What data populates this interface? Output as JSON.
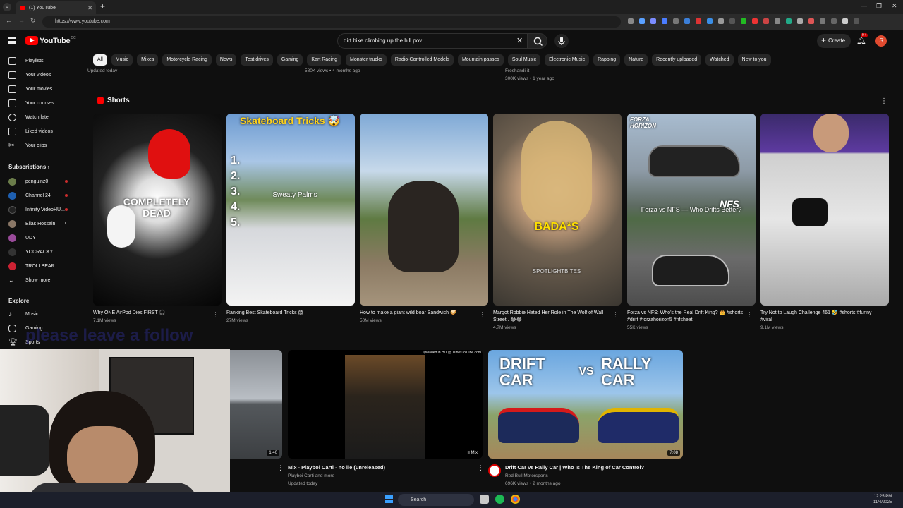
{
  "browser": {
    "tab_title": "(1) YouTube",
    "url": "https://www.youtube.com",
    "new_tab": "+"
  },
  "header": {
    "logo_text": "YouTube",
    "country_code": "CC",
    "search_query": "dirt bike climbing up the hill pov",
    "create_label": "Create",
    "notif_count": "9+",
    "avatar_letter": "S"
  },
  "chips": [
    "All",
    "Music",
    "Mixes",
    "Motorcycle Racing",
    "News",
    "Test drives",
    "Gaming",
    "Kart Racing",
    "Monster trucks",
    "Radio-Controlled Models",
    "Mountain passes",
    "Soul Music",
    "Electronic Music",
    "Rapping",
    "Nature",
    "Recently uploaded",
    "Watched",
    "New to you"
  ],
  "sidebar": {
    "you_items": [
      "Playlists",
      "Your videos",
      "Your movies",
      "Your courses",
      "Watch later",
      "Liked videos",
      "Your clips"
    ],
    "subscriptions_title": "Subscriptions",
    "subscriptions": [
      "penguinz0",
      "Channel 24",
      "Infinity VideoHU...",
      "Elias Hossain",
      "UDY",
      "YOCRACKY",
      "TROLI BEAR"
    ],
    "show_more": "Show more",
    "explore_title": "Explore",
    "explore_items": [
      "Music",
      "Gaming",
      "Sports"
    ]
  },
  "previous_row": {
    "left_meta": "Updated today",
    "mid_meta": "580K views • 4 months ago",
    "right_channel": "Freshandi-it",
    "right_meta": "300K views • 1 year ago"
  },
  "shorts": {
    "title": "Shorts",
    "items": [
      {
        "title": "Why ONE AirPod Dies FIRST 🎧",
        "views": "7.1M views",
        "overlay": "COMPLETELY DEAD"
      },
      {
        "title": "Ranking Best Skateboard Tricks 😱",
        "views": "27M views",
        "overlay": "Skateboard Tricks 🤯",
        "overlay2": "1.\n2.\n3.\n4.\n5.",
        "overlay3": "Sweaty Palms"
      },
      {
        "title": "How to make a giant wild boar Sandwich 🥪",
        "views": "50M views",
        "overlay": ""
      },
      {
        "title": "Margot Robbie Hated Her Role in The Wolf of Wall Street.. 😂😂",
        "views": "4.7M views",
        "overlay": "BADA*S",
        "overlay2": "SPOTLIGHTBITES"
      },
      {
        "title": "Forza vs NFS: Who's the Real Drift King? 👑 #shorts #drift #forzahorizon5 #nfsheat",
        "views": "55K views",
        "overlay": "Forza vs NFS — Who Drifts Better?",
        "overlay2": "FORZA HORIZON",
        "overlay3": "NFS"
      },
      {
        "title": "Try Not to Laugh Challenge 461 🤣 #shorts #funny #viral",
        "views": "9.1M views",
        "overlay": ""
      }
    ]
  },
  "videos": [
    {
      "title": "",
      "meta1": "",
      "meta2": "",
      "duration": "1:40"
    },
    {
      "title": "Mix - Playboi Carti - no lie (unreleased)",
      "meta1": "Playboi Carti and more",
      "meta2": "Updated today",
      "duration": "Mix",
      "banner": "uploaded in HD @ TunesToTube.com"
    },
    {
      "title": "Drift Car vs Rally Car | Who Is The King of Car Control?",
      "meta1": "Red Bull Motorsports",
      "meta2": "696K views • 2 months ago",
      "duration": "7:08",
      "thumb_left": "DRIFT CAR",
      "thumb_vs": "VS",
      "thumb_right": "RALLY CAR"
    }
  ],
  "overlay_caption": "please leave a follow",
  "taskbar": {
    "search_label": "Search",
    "time": "12:25 PM",
    "date": "11/4/2025"
  }
}
